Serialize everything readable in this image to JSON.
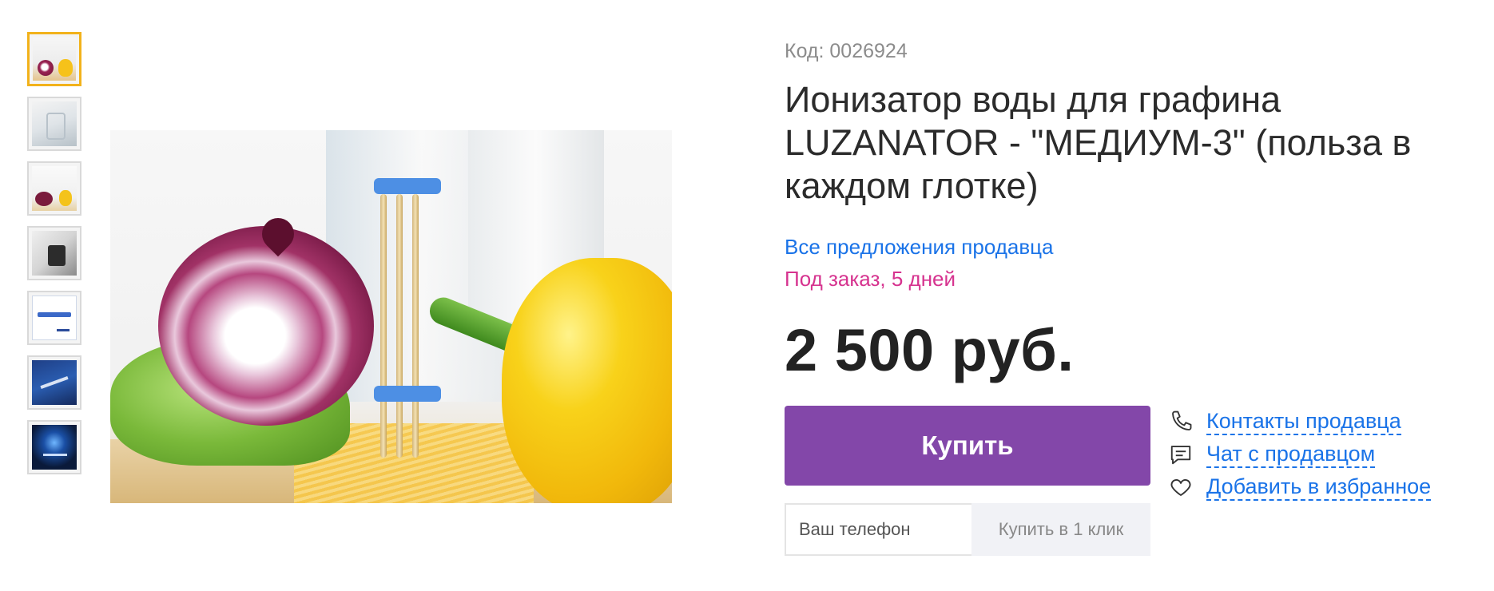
{
  "gallery": {
    "thumbnails": [
      {
        "alt": "thumb-1",
        "active": true
      },
      {
        "alt": "thumb-2",
        "active": false
      },
      {
        "alt": "thumb-3",
        "active": false
      },
      {
        "alt": "thumb-4",
        "active": false
      },
      {
        "alt": "thumb-5",
        "active": false
      },
      {
        "alt": "thumb-6",
        "active": false
      },
      {
        "alt": "thumb-7",
        "active": false
      }
    ],
    "active_border_color": "#f2b21b"
  },
  "product": {
    "code": "Код: 0026924",
    "title": "Ионизатор воды для графина LUZANATOR - \"МЕДИУМ-3\" (польза в каждом глотке)",
    "seller_link": "Все предложения продавца",
    "availability": "Под заказ, 5 дней",
    "price": "2 500 руб."
  },
  "purchase": {
    "buy_label": "Купить",
    "phone_placeholder": "Ваш телефон",
    "phone_value": "",
    "one_click_label": "Купить в 1 клик"
  },
  "actions": {
    "contacts": {
      "label": "Контакты продавца",
      "icon": "phone-icon"
    },
    "chat": {
      "label": "Чат с продавцом",
      "icon": "chat-icon"
    },
    "favorite": {
      "label": "Добавить в избранное",
      "icon": "heart-icon"
    }
  },
  "colors": {
    "accent_buy": "#8347a9",
    "link": "#1a73e8",
    "availability": "#d6338f",
    "code_gray": "#8c8c8c"
  }
}
